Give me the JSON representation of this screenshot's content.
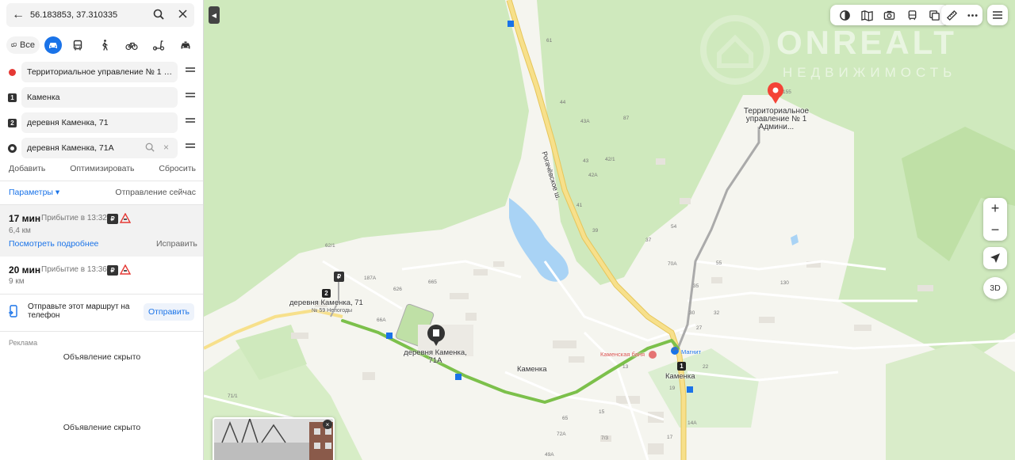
{
  "search": {
    "coords": "56.183853, 37.310335"
  },
  "modes": {
    "all_label": "Все",
    "items": [
      "car-icon",
      "bus-icon",
      "pedestrian-icon",
      "bicycle-icon",
      "scooter-icon",
      "taxi-icon"
    ],
    "active": "car-icon"
  },
  "waypoints": [
    {
      "marker": "",
      "marker_style": "red-dot",
      "value": "Территориальное управление № 1 Адм..."
    },
    {
      "marker": "1",
      "marker_style": "square",
      "value": "Каменка"
    },
    {
      "marker": "2",
      "marker_style": "square",
      "value": "деревня Каменка, 71"
    },
    {
      "marker": "",
      "marker_style": "ring",
      "value": "деревня Каменка, 71А"
    }
  ],
  "actions": {
    "add": "Добавить",
    "optimize": "Оптимизировать",
    "reset": "Сбросить"
  },
  "params": {
    "label": "Параметры ▾",
    "depart": "Отправление сейчас"
  },
  "routes": [
    {
      "time": "17 мин",
      "arrival": "Прибытие в 13:32",
      "toll_badge": "₽",
      "distance": "6,4 км",
      "details": "Посмотреть подробнее",
      "fix": "Исправить"
    },
    {
      "time": "20 мин",
      "arrival": "Прибытие в 13:36",
      "toll_badge": "₽",
      "distance": "9 км"
    }
  ],
  "send": {
    "text": "Отправьте этот маршрут на телефон",
    "button": "Отправить"
  },
  "ads": {
    "label": "Реклама",
    "hidden_1": "Объявление скрыто",
    "hidden_2": "Объявление скрыто"
  },
  "map": {
    "labels": {
      "road": "Рогачёвское ш.",
      "kamenka": "Каменка",
      "kamenka_stop": "Каменка",
      "village71": "деревня Каменка, 71",
      "village71a": "деревня Каменка, 71А",
      "bus59": "№ 59 Непогоды",
      "banya": "Каменская баня",
      "magnit": "Магнит",
      "admin": "Территориальное управление № 1 Админи..."
    },
    "markers": {
      "stop1": "1",
      "stop2": "2"
    },
    "house_numbers": [
      "61",
      "44",
      "87",
      "43А",
      "42/1",
      "42А",
      "43",
      "41",
      "39",
      "37",
      "54",
      "55",
      "70А",
      "35",
      "32",
      "30",
      "27",
      "130",
      "24",
      "22",
      "19",
      "17",
      "14А",
      "15",
      "7/3",
      "72А",
      "49А",
      "187А",
      "665",
      "626",
      "66А",
      "62/1",
      "71/1",
      "64",
      "65",
      "13",
      "155"
    ],
    "buttons": {
      "zoom_in": "+",
      "zoom_out": "−",
      "three_d": "3D"
    },
    "watermark": {
      "brand": "ONREALT",
      "sub": "НЕДВИЖИМОСТЬ"
    },
    "colors": {
      "route": "#7cc04b",
      "highway": "#f7e08b",
      "forest": "#cfe9bd",
      "water": "#a9d3f5",
      "pin": "#f44336"
    }
  }
}
